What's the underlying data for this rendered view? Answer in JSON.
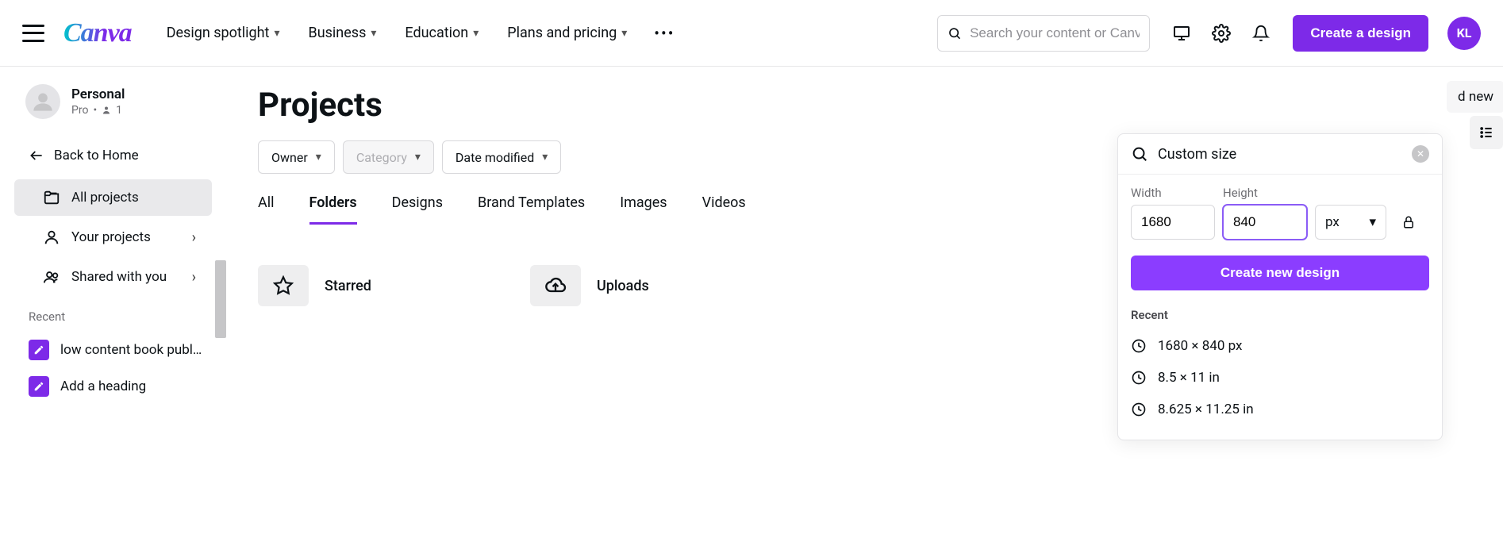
{
  "header": {
    "logo_text": "Canva",
    "nav": [
      "Design spotlight",
      "Business",
      "Education",
      "Plans and pricing"
    ],
    "search_placeholder": "Search your content or Canva's",
    "create_button": "Create a design",
    "avatar_initials": "KL"
  },
  "sidebar": {
    "account_name": "Personal",
    "account_plan": "Pro",
    "account_members": "1",
    "back_label": "Back to Home",
    "items": [
      {
        "label": "All projects",
        "icon": "folders-icon",
        "active": true,
        "chevron": false
      },
      {
        "label": "Your projects",
        "icon": "person-icon",
        "active": false,
        "chevron": true
      },
      {
        "label": "Shared with you",
        "icon": "people-icon",
        "active": false,
        "chevron": true
      }
    ],
    "recent_label": "Recent",
    "recent": [
      {
        "label": "low content book publ…"
      },
      {
        "label": "Add a heading"
      }
    ]
  },
  "main": {
    "title": "Projects",
    "filters": [
      {
        "label": "Owner",
        "disabled": false
      },
      {
        "label": "Category",
        "disabled": true
      },
      {
        "label": "Date modified",
        "disabled": false
      }
    ],
    "tabs": [
      "All",
      "Folders",
      "Designs",
      "Brand Templates",
      "Images",
      "Videos"
    ],
    "active_tab": "Folders",
    "folders": [
      {
        "label": "Starred",
        "icon": "star"
      },
      {
        "label": "Uploads",
        "icon": "cloud"
      }
    ],
    "partial_button": "d new"
  },
  "popover": {
    "title": "Custom size",
    "width_label": "Width",
    "height_label": "Height",
    "width_value": "1680",
    "height_value": "840",
    "unit": "px",
    "create_label": "Create new design",
    "recent_label": "Recent",
    "recent_sizes": [
      "1680 × 840 px",
      "8.5 × 11 in",
      "8.625 × 11.25 in"
    ]
  }
}
